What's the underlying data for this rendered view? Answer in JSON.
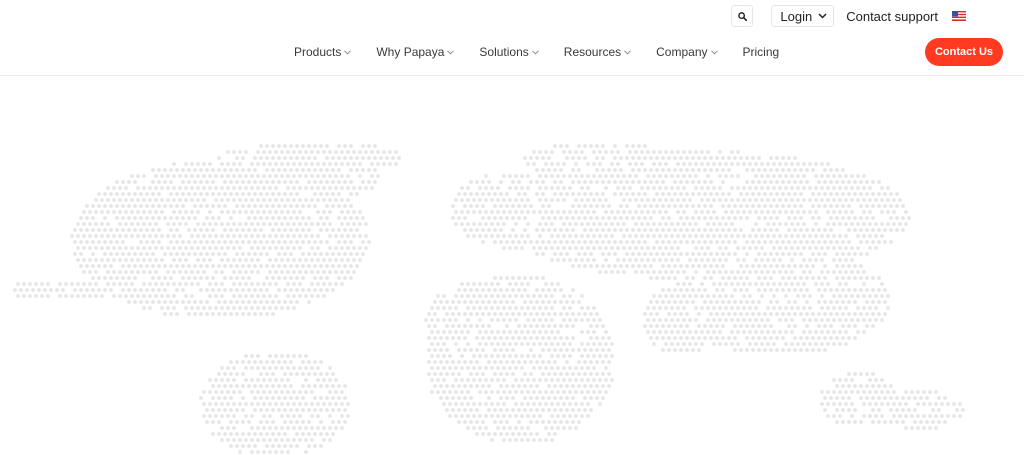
{
  "utility": {
    "login_label": "Login",
    "contact_support_label": "Contact support",
    "search_icon": "search-icon",
    "flag_icon": "us-flag-icon"
  },
  "nav": {
    "items": [
      {
        "label": "Products",
        "has_dropdown": true
      },
      {
        "label": "Why Papaya",
        "has_dropdown": true
      },
      {
        "label": "Solutions",
        "has_dropdown": true
      },
      {
        "label": "Resources",
        "has_dropdown": true
      },
      {
        "label": "Company",
        "has_dropdown": true
      },
      {
        "label": "Pricing",
        "has_dropdown": false
      }
    ],
    "cta_label": "Contact Us"
  },
  "colors": {
    "accent": "#ff3a21",
    "map_dot": "#e6e6e6"
  }
}
